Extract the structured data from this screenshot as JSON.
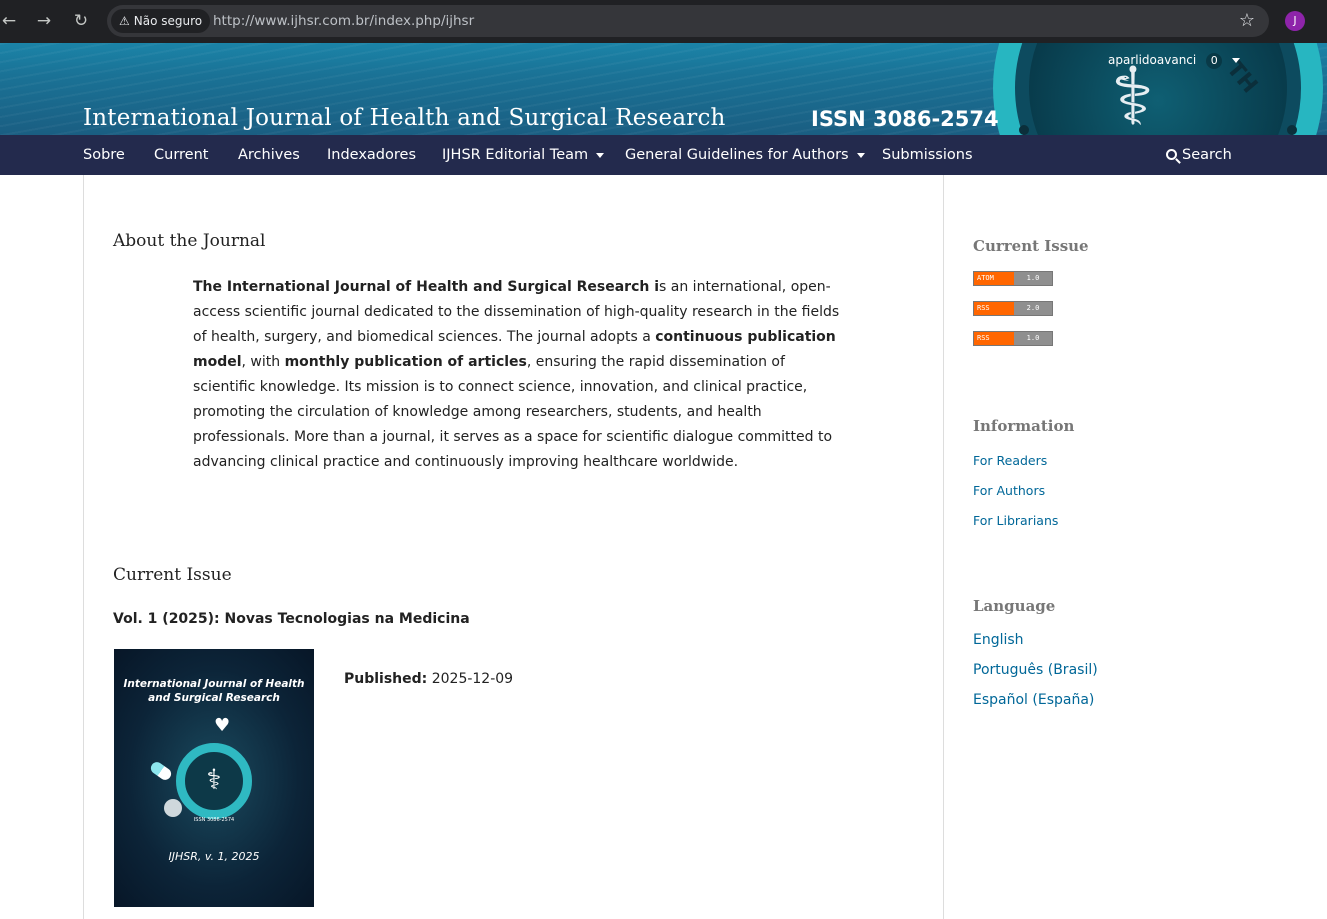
{
  "browser": {
    "security_label": "Não seguro",
    "url": "http://www.ijhsr.com.br/index.php/ijhsr",
    "profile_initial": "J"
  },
  "header": {
    "title": "International Journal of Health and Surgical Research",
    "issn": "ISSN 3086-2574",
    "username": "aparlidoavanci",
    "notification_count": "0",
    "colors": {
      "header_top": "#1b84a8",
      "header_bottom": "#1a5e82",
      "nav": "#232a4d",
      "accent": "#27b6c1"
    }
  },
  "nav": {
    "items": [
      {
        "label": "Sobre"
      },
      {
        "label": "Current"
      },
      {
        "label": "Archives"
      },
      {
        "label": "Indexadores"
      },
      {
        "label": "IJHSR Editorial Team"
      },
      {
        "label": "General Guidelines for Authors"
      },
      {
        "label": "Submissions"
      }
    ],
    "search_label": "Search"
  },
  "main": {
    "about_title": "About the Journal",
    "about_lead_bold": "The International Journal of Health and Surgical Research i",
    "about_part1": "s an international, open-access scientific journal dedicated to the dissemination of high-quality research in the fields of health, surgery, and biomedical sciences. The journal adopts a ",
    "about_bold2": "continuous publication model",
    "about_part2": ", with ",
    "about_bold3": "monthly publication of articles",
    "about_part3": ", ensuring the rapid dissemination of scientific knowledge. Its mission is to connect science, innovation, and clinical practice, promoting the circulation of knowledge among researchers, students, and health professionals. More than a journal, it serves as a space for scientific dialogue committed to advancing clinical practice and continuously improving healthcare worldwide.",
    "current_issue_title": "Current Issue",
    "issue_identification": "Vol. 1 (2025): Novas Tecnologias na Medicina",
    "published_label": "Published:",
    "published_date": "2025-12-09",
    "cover": {
      "title": "International Journal of Health and Surgical Research",
      "badge_text": "INT. J. HEALTH SURG. RES.",
      "issn": "ISSN 3086-2574",
      "volume": "IJHSR, v. 1, 2025"
    }
  },
  "sidebar": {
    "current_issue_title": "Current Issue",
    "feeds": [
      {
        "type": "ATOM",
        "version": "1.0"
      },
      {
        "type": "RSS",
        "version": "2.0"
      },
      {
        "type": "RSS",
        "version": "1.0"
      }
    ],
    "information_title": "Information",
    "information_links": [
      "For Readers",
      "For Authors",
      "For Librarians"
    ],
    "language_title": "Language",
    "languages": [
      "English",
      "Português (Brasil)",
      "Español (España)"
    ]
  }
}
